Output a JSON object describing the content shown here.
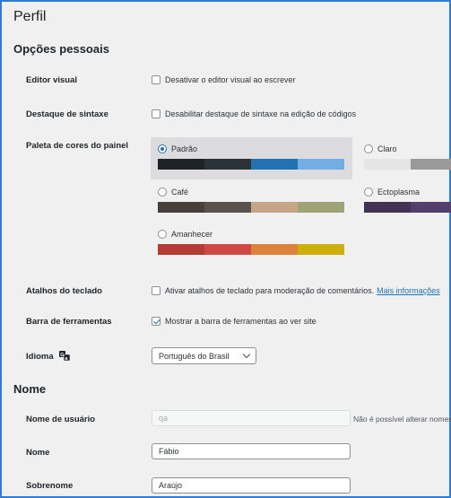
{
  "page": {
    "title": "Perfil"
  },
  "sections": {
    "personal": "Opções pessoais",
    "name": "Nome"
  },
  "visual_editor": {
    "label": "Editor visual",
    "option": "Desativar o editor visual ao escrever",
    "checked": false
  },
  "syntax": {
    "label": "Destaque de sintaxe",
    "option": "Desabilitar destaque de sintaxe na edição de códigos",
    "checked": false
  },
  "color_scheme": {
    "label": "Paleta de cores do painel",
    "schemes": [
      {
        "name": "Padrão",
        "selected": true,
        "colors": [
          "#1d2327",
          "#2c3338",
          "#2271b1",
          "#72aee6"
        ]
      },
      {
        "name": "Claro",
        "selected": false,
        "colors": [
          "#e5e5e5",
          "#999999",
          "#d64e07",
          "#04a4cc"
        ]
      },
      {
        "name": "Café",
        "selected": false,
        "colors": [
          "#46403c",
          "#59524c",
          "#c7a589",
          "#9ea476"
        ]
      },
      {
        "name": "Ectoplasma",
        "selected": false,
        "colors": [
          "#413256",
          "#523f6d",
          "#a3b745",
          "#d46f15"
        ]
      },
      {
        "name": "Amanhecer",
        "selected": false,
        "colors": [
          "#b43c38",
          "#cf4944",
          "#dd823b",
          "#ccaf0b"
        ]
      }
    ]
  },
  "shortcuts": {
    "label": "Atalhos do teclado",
    "option": "Ativar atalhos de teclado para moderação de comentários.",
    "link": "Mais informações",
    "checked": false
  },
  "toolbar": {
    "label": "Barra de ferramentas",
    "option": "Mostrar a barra de ferramentas ao ver site",
    "checked": true
  },
  "language": {
    "label": "Idioma",
    "icon": "translation-icon",
    "selected": "Português do Brasil"
  },
  "username": {
    "label": "Nome de usuário",
    "value": "qa",
    "note": "Não é possível alterar nomes"
  },
  "first_name": {
    "label": "Nome",
    "value": "Fábio"
  },
  "last_name": {
    "label": "Sobrenome",
    "value": "Araújo"
  }
}
